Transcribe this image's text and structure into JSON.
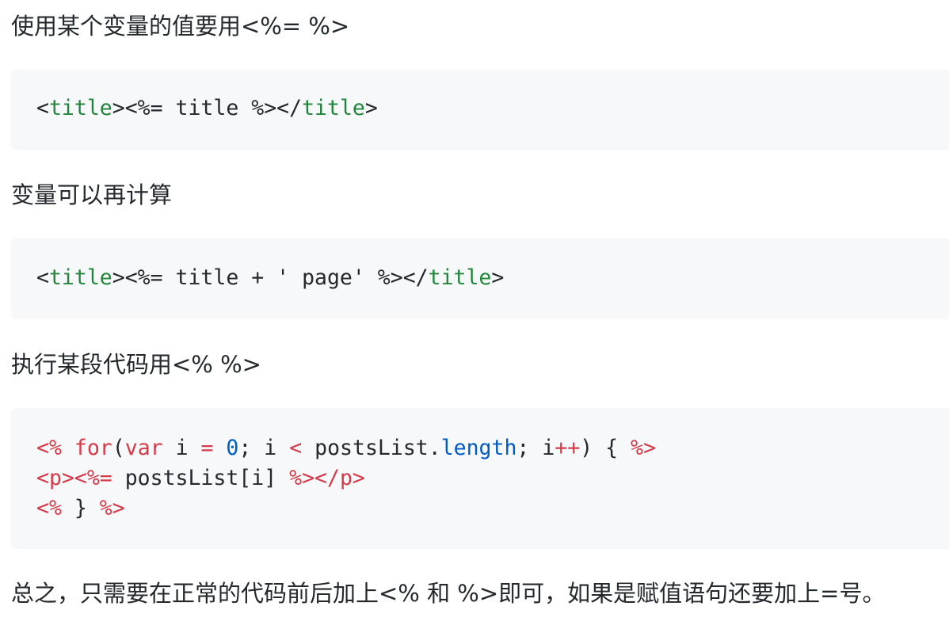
{
  "paragraphs": {
    "p1": "使用某个变量的值要用<%= %>",
    "p2": "变量可以再计算",
    "p3": "执行某段代码用<% %>",
    "p4": "总之，只需要在正常的代码前后加上<% 和 %>即可，如果是赋值语句还要加上=号。"
  },
  "code1": {
    "line1": [
      "<",
      "title",
      "><%= title %></",
      "title",
      ">"
    ]
  },
  "code2": {
    "line1": [
      "<",
      "title",
      "><%= title + ' page' %></",
      "title",
      ">"
    ]
  },
  "code3": {
    "line1": [
      "<%",
      " ",
      "for",
      "(",
      "var",
      " i ",
      "=",
      " ",
      "0",
      "; i ",
      "<",
      " postsList.",
      "length",
      "; i",
      "++",
      ") { ",
      "%>"
    ],
    "line2": [
      "<p>",
      "<%=",
      " postsList[i] ",
      "%>",
      "</p>"
    ],
    "line3": [
      "<%",
      " } ",
      "%>"
    ]
  },
  "colors": {
    "text": "#24292e",
    "tag": "#22863a",
    "keyword": "#d73a49",
    "number": "#005cc5",
    "code_background": "#f6f8fa"
  }
}
